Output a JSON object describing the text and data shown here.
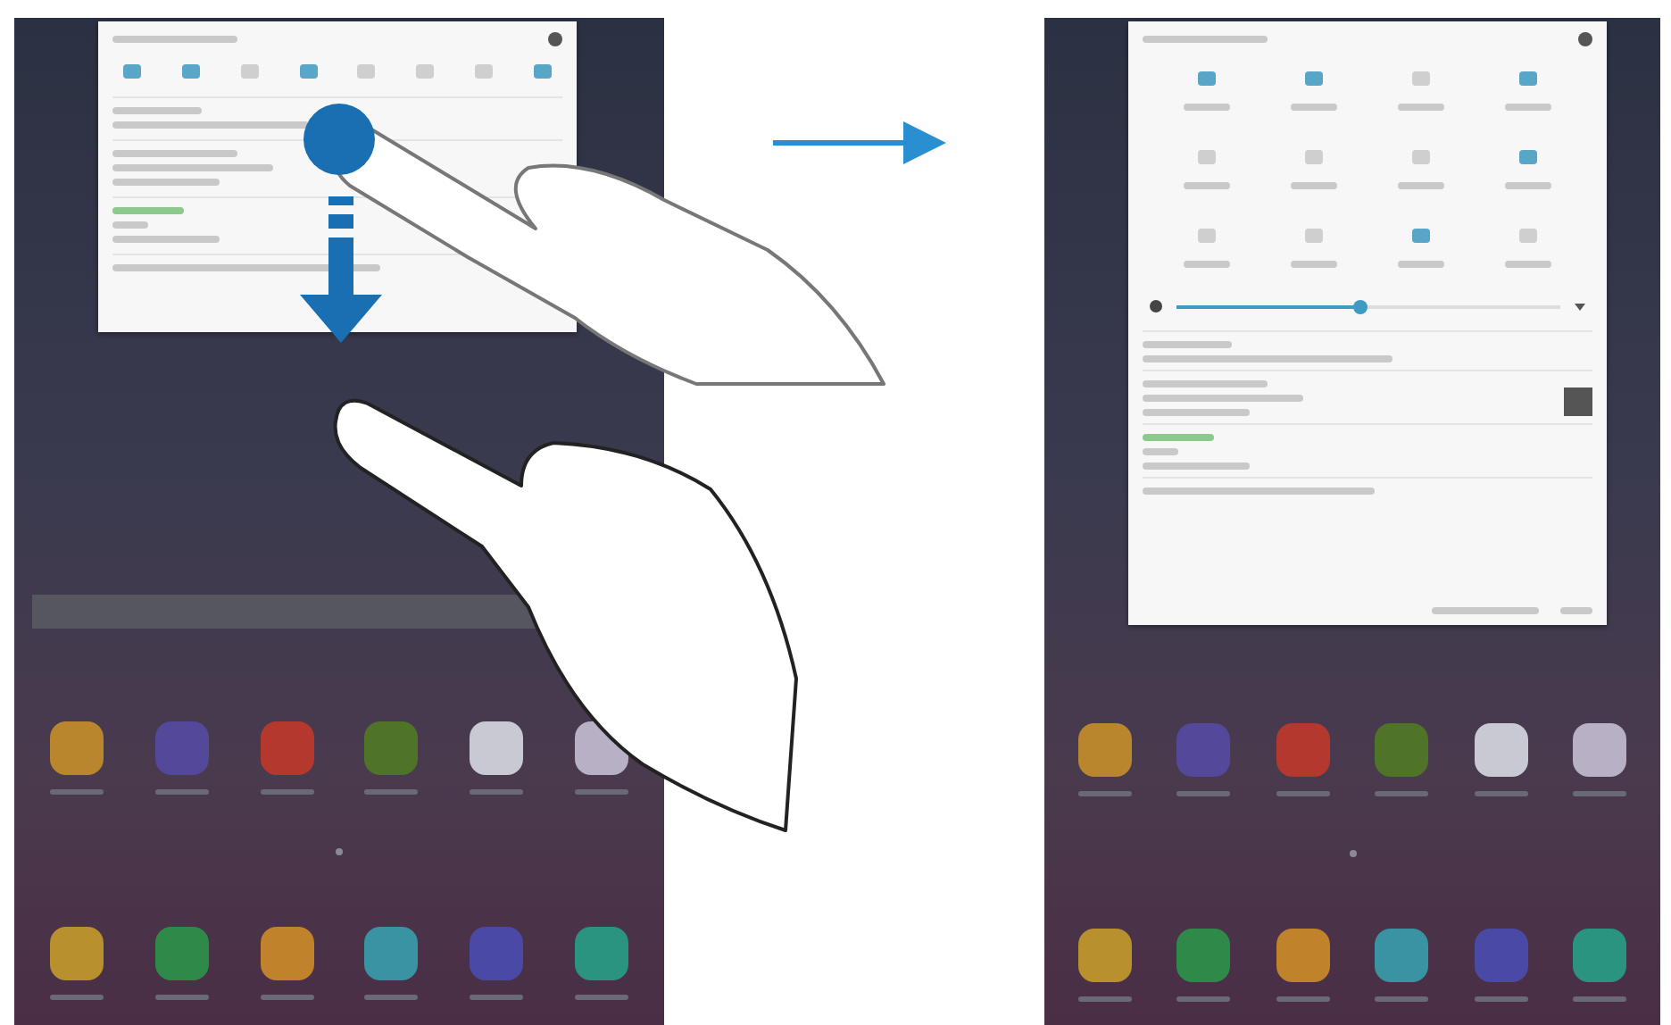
{
  "left_screen": {
    "quick_toggles": [
      {
        "on": true
      },
      {
        "on": true
      },
      {
        "on": false
      },
      {
        "on": true
      },
      {
        "on": false
      },
      {
        "on": false
      },
      {
        "on": false
      },
      {
        "on": true
      }
    ]
  },
  "right_screen": {
    "quick_panel_toggles": [
      {
        "on": true
      },
      {
        "on": true
      },
      {
        "on": false
      },
      {
        "on": true
      },
      {
        "on": false
      },
      {
        "on": false
      },
      {
        "on": false
      },
      {
        "on": true
      },
      {
        "on": false
      },
      {
        "on": false
      },
      {
        "on": true
      },
      {
        "on": false
      }
    ],
    "brightness": {
      "level": 0.48
    }
  },
  "home_apps": [
    {
      "color": "#b9862e"
    },
    {
      "color": "#54489a"
    },
    {
      "color": "#b4382e"
    },
    {
      "color": "#4f7428"
    },
    {
      "color": "#c9c9d3"
    },
    {
      "color": "#b8b0c4"
    }
  ],
  "dock_apps": [
    {
      "color": "#b8902e"
    },
    {
      "color": "#2e8a48"
    },
    {
      "color": "#c0822a"
    },
    {
      "color": "#3a93a3"
    },
    {
      "color": "#4a4aa6"
    },
    {
      "color": "#2a9480"
    }
  ]
}
